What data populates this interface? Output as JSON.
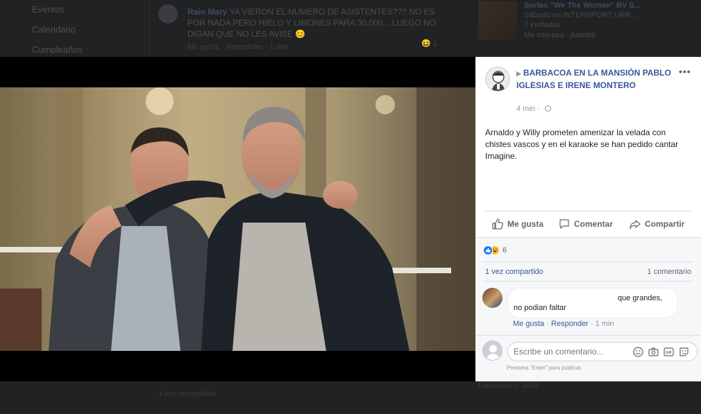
{
  "background": {
    "left_nav": [
      "Eventos",
      "Calendario",
      "Cumpleaños"
    ],
    "feed_comment": {
      "author": "Raio Mary",
      "text": " YA VIERON EL NUMERO DE ASISTENTES??? NO ES POR NADA PERO HIELO Y LIMONES PARA 30.000....LUEGO NO DIGAN QUE NO LES AVISE 😊",
      "meta": "Me gusta · Responder · 1 min",
      "reaction_count": "1"
    },
    "event": {
      "title": "Sorteo \"We The Women\" BV S...",
      "line1": "Sábado en INTERSPORT URR...",
      "line2": "7 invitados",
      "line3": "Me interesa · Asistiré"
    },
    "bottom_shared": "1 vez compartido",
    "bottom_right": "Facebook © 2018"
  },
  "post": {
    "title": "BARBACOA EN LA MANSIÓN PABLO IGLESIAS E IRENE MONTERO",
    "time": "4 min",
    "body": "Arnaldo y Willy prometen amenizar la velada con chistes vascos y en el karaoke se han pedido cantar Imagine.",
    "actions": {
      "like": "Me gusta",
      "comment": "Comentar",
      "share": "Compartir"
    },
    "reaction_count": "6",
    "shared_count": "1 vez compartido",
    "comment_count": "1 comentario"
  },
  "comment": {
    "line1": "que grandes,",
    "line2": "no podian faltar",
    "like": "Me gusta",
    "reply": "Responder",
    "time": "1 min"
  },
  "composer": {
    "placeholder": "Escribe un comentario...",
    "hint": "Presiona \"Enter\" para publicar."
  },
  "colors": {
    "link": "#365899",
    "like_blue": "#1877f2",
    "haha_yellow": "#f7b928"
  }
}
